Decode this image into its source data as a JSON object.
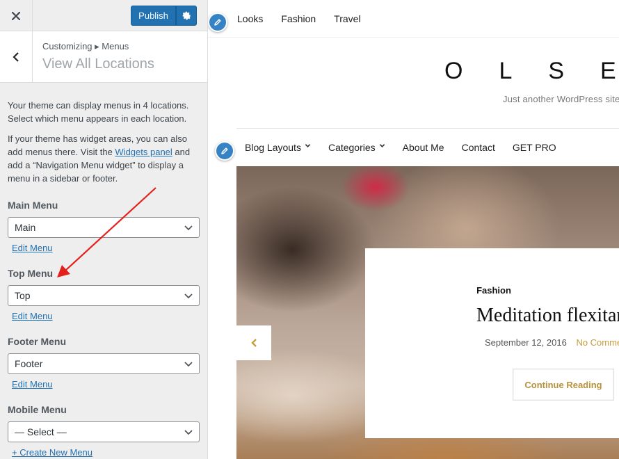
{
  "customizer": {
    "close_icon": "close-icon",
    "publish_label": "Publish",
    "breadcrumb": "Customizing ▸ Menus",
    "section_title": "View All Locations",
    "description_1": "Your theme can display menus in 4 locations. Select which menu appears in each location.",
    "description_2_before": "If your theme has widget areas, you can also add menus there. Visit the ",
    "widgets_link": "Widgets panel",
    "description_2_after": " and add a “Navigation Menu widget” to display a menu in a sidebar or footer.",
    "locations": [
      {
        "label": "Main Menu",
        "selected": "Main",
        "link": "Edit Menu"
      },
      {
        "label": "Top Menu",
        "selected": "Top",
        "link": "Edit Menu"
      },
      {
        "label": "Footer Menu",
        "selected": "Footer",
        "link": "Edit Menu"
      },
      {
        "label": "Mobile Menu",
        "selected": "— Select —",
        "link": "+ Create New Menu"
      }
    ]
  },
  "preview": {
    "top_nav": [
      "Looks",
      "Fashion",
      "Travel"
    ],
    "logo": "OLSEN",
    "tagline": "Just another WordPress site",
    "main_nav": [
      {
        "label": "Blog Layouts",
        "has_dropdown": true
      },
      {
        "label": "Categories",
        "has_dropdown": true
      },
      {
        "label": "About Me",
        "has_dropdown": false
      },
      {
        "label": "Contact",
        "has_dropdown": false
      },
      {
        "label": "GET PRO",
        "has_dropdown": false
      }
    ],
    "post": {
      "category": "Fashion",
      "title": "Meditation flexitarian",
      "date": "September 12, 2016",
      "comments": "No Comments",
      "button": "Continue Reading"
    }
  },
  "colors": {
    "primary_button": "#2271b1",
    "edit_shortcut": "#3582c4",
    "accent_gold": "#c69c3c",
    "annotation_arrow": "#e3201b"
  }
}
